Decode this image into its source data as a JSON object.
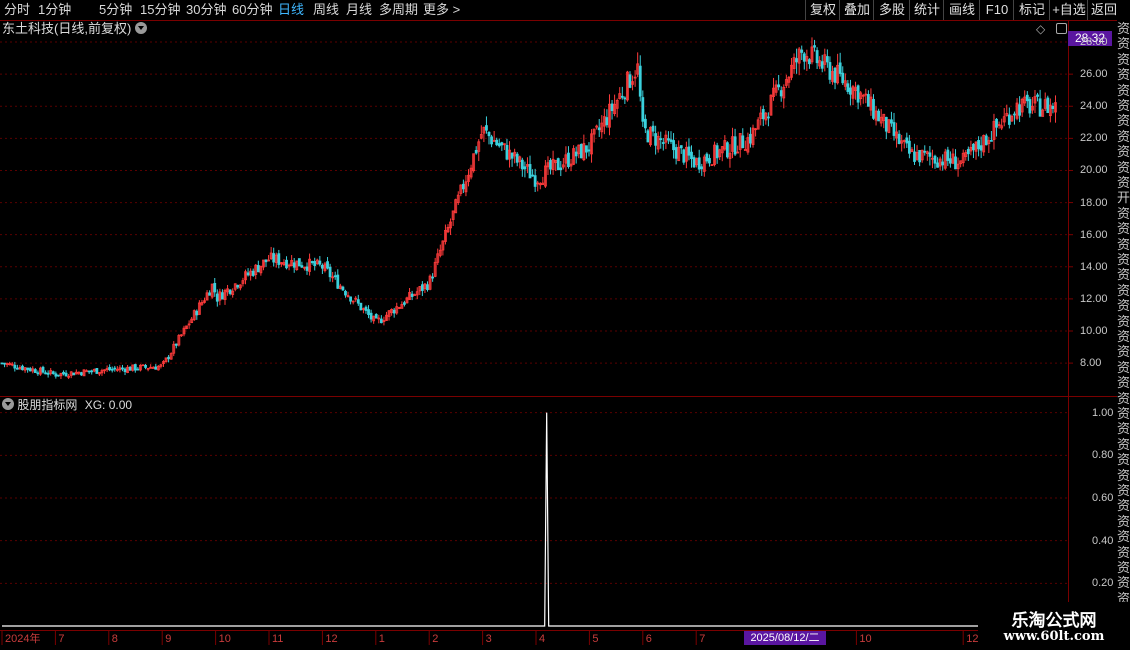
{
  "toolbar": {
    "periods": [
      "分时",
      "1分钟",
      "5分钟",
      "15分钟",
      "30分钟",
      "60分钟",
      "日线",
      "周线",
      "月线",
      "多周期",
      "更多 >"
    ],
    "active_period": "日线",
    "actions": [
      "复权",
      "叠加",
      "多股",
      "统计",
      "画线",
      "F10",
      "标记",
      "+自选",
      "返回"
    ]
  },
  "main_chart": {
    "title": "东土科技(日线,前复权)",
    "current_price": "28.32",
    "up_color": "#ff3b3b",
    "down_color": "#3ad0dc"
  },
  "indicator": {
    "title": "股朋指标网",
    "value_text": "XG: 0.00"
  },
  "chart_data": [
    {
      "type": "candlestick",
      "title": "东土科技(日线,前复权)",
      "x_range": [
        "2024-06",
        "2026-01"
      ],
      "ylim": [
        6.2,
        29.0
      ],
      "y_ticks": [
        "28.00",
        "26.00",
        "24.00",
        "22.00",
        "20.00",
        "18.00",
        "16.00",
        "14.00",
        "12.00",
        "10.00",
        "8.00"
      ],
      "grid": true,
      "close_path": [
        {
          "date": "2024-06",
          "close": 8.0
        },
        {
          "date": "2024-07",
          "close": 7.3
        },
        {
          "date": "2024-08",
          "close": 7.6
        },
        {
          "date": "2024-09",
          "close": 7.8
        },
        {
          "date": "2024-09-30",
          "close": 13.0
        },
        {
          "date": "2024-10",
          "close": 12.0
        },
        {
          "date": "2024-11",
          "close": 14.5
        },
        {
          "date": "2024-12",
          "close": 14.0
        },
        {
          "date": "2025-01",
          "close": 10.5
        },
        {
          "date": "2025-02",
          "close": 13.0
        },
        {
          "date": "2025-03",
          "close": 22.5
        },
        {
          "date": "2025-04",
          "close": 19.5
        },
        {
          "date": "2025-05",
          "close": 21.5
        },
        {
          "date": "2025-05-28",
          "close": 26.5
        },
        {
          "date": "2025-06",
          "close": 22.5
        },
        {
          "date": "2025-07",
          "close": 20.5
        },
        {
          "date": "2025-08",
          "close": 22.0
        },
        {
          "date": "2025-09",
          "close": 27.5
        },
        {
          "date": "2025-10",
          "close": 25.0
        },
        {
          "date": "2025-11",
          "close": 21.0
        },
        {
          "date": "2025-12",
          "close": 20.5
        },
        {
          "date": "2026-01",
          "close": 24.0
        }
      ]
    },
    {
      "type": "line",
      "title": "股朋指标网",
      "series": [
        {
          "name": "XG",
          "x": [
            "2025-04-07"
          ],
          "values": [
            1.0
          ]
        }
      ],
      "ylim": [
        0,
        1.05
      ],
      "y_ticks": [
        "1.00",
        "0.80",
        "0.60",
        "0.40",
        "0.20"
      ]
    }
  ],
  "date_axis": {
    "labels": [
      "2024年",
      "7",
      "8",
      "9",
      "10",
      "11",
      "12",
      "1",
      "2",
      "3",
      "4",
      "5",
      "6",
      "7",
      "8",
      "10",
      "12",
      "1"
    ],
    "cursor_date": "2025/08/12/二"
  },
  "side_strip": {
    "chars": [
      "资",
      "资",
      "资",
      "资",
      "资",
      "资",
      "资",
      "资",
      "资",
      "资",
      "资",
      "开",
      "资",
      "资",
      "资",
      "资",
      "资",
      "资",
      "资",
      "资",
      "资",
      "资",
      "资",
      "资",
      "资",
      "资",
      "资",
      "资",
      "资",
      "资",
      "资",
      "资",
      "资",
      "资",
      "资",
      "资",
      "资",
      "资",
      "资"
    ]
  },
  "watermark": {
    "title": "乐淘公式网",
    "url": "www.60lt.com"
  }
}
